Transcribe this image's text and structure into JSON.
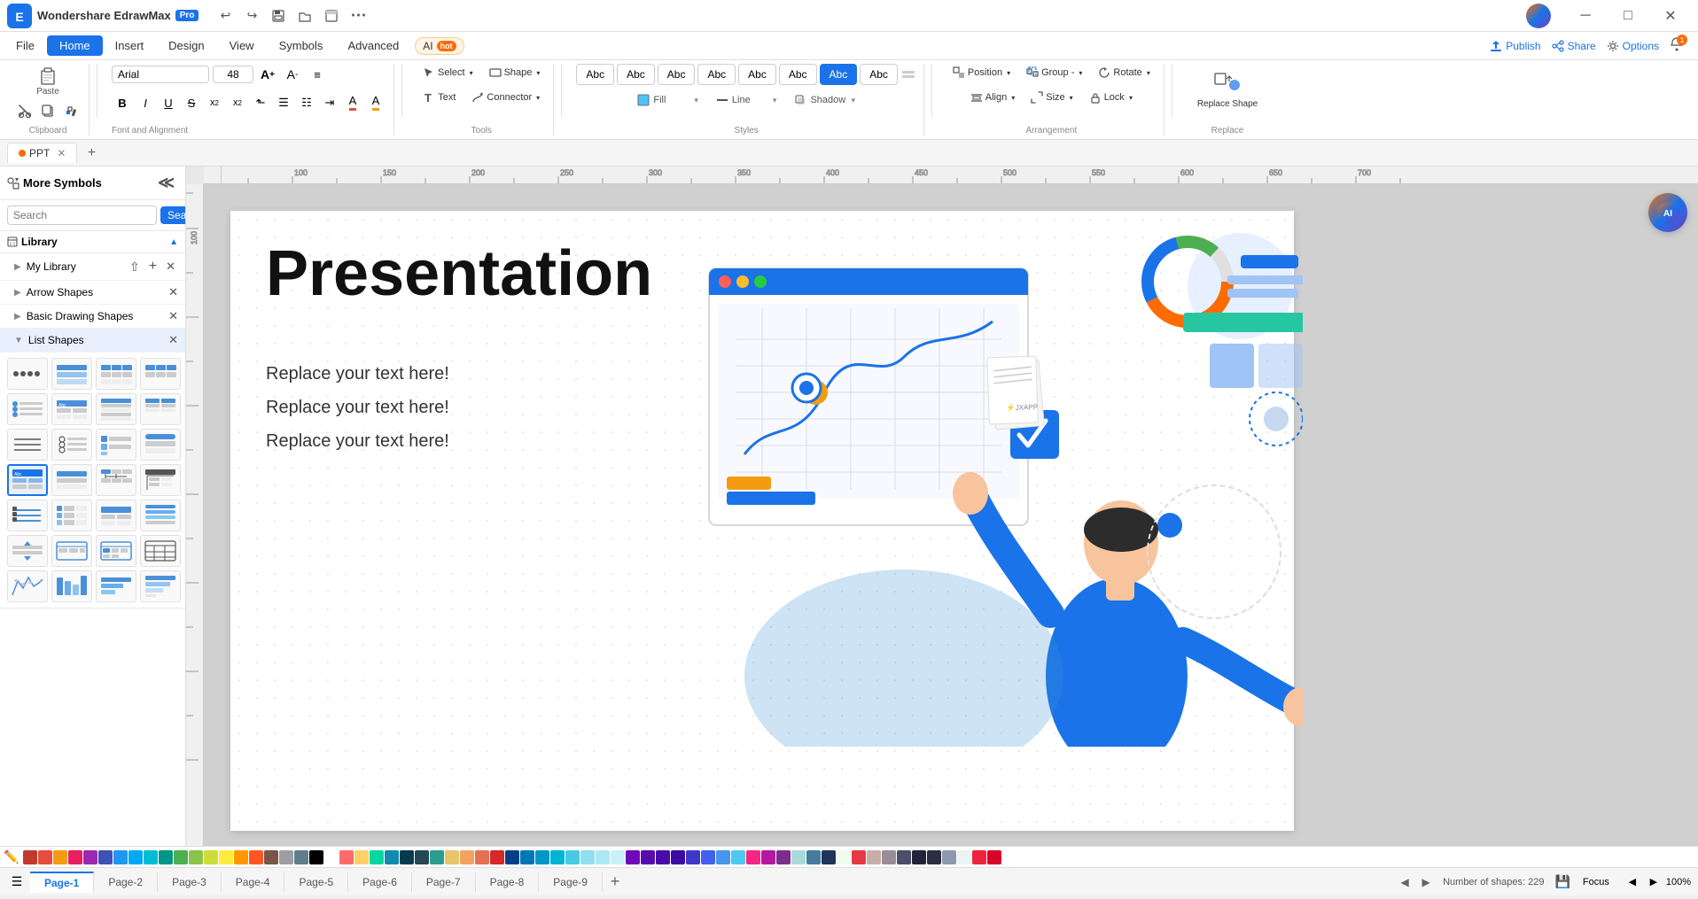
{
  "app": {
    "name": "Wondershare EdrawMax",
    "pro_badge": "Pro",
    "title": "Wondershare EdrawMax"
  },
  "titlebar": {
    "undo": "↩",
    "redo": "↪",
    "save_icon": "💾",
    "open_icon": "📂",
    "minimize": "─",
    "maximize": "□",
    "close": "✕",
    "more": "⋯"
  },
  "menubar": {
    "items": [
      "File",
      "Home",
      "Insert",
      "Design",
      "View",
      "Symbols",
      "Advanced"
    ],
    "active": "Home",
    "ai_label": "AI",
    "hot": "hot",
    "publish": "Publish",
    "share": "Share",
    "options": "Options"
  },
  "toolbar": {
    "clipboard_label": "Clipboard",
    "font_label": "Font and Alignment",
    "tools_label": "Tools",
    "styles_label": "Styles",
    "arrangement_label": "Arrangement",
    "replace_label": "Replace",
    "cut": "✂",
    "copy": "⧉",
    "paste": "📋",
    "format_painter": "🖌",
    "font_name": "Arial",
    "font_size": "48",
    "font_increase": "A+",
    "font_decrease": "A-",
    "align_icon": "≡",
    "bold": "B",
    "italic": "I",
    "underline": "U",
    "strikethrough": "S",
    "superscript": "x²",
    "subscript": "x₂",
    "text_align": "≡",
    "bullet_list": "☰",
    "numbered_list": "☷",
    "text_color": "A",
    "highlight": "A",
    "select_label": "Select",
    "shape_label": "Shape",
    "text_label": "Text",
    "connector_label": "Connector",
    "fill_label": "Fill",
    "line_label": "Line",
    "shadow_label": "Shadow",
    "position_label": "Position",
    "group_label": "Group -",
    "rotate_label": "Rotate",
    "align_label": "Align",
    "size_label": "Size",
    "lock_label": "Lock",
    "replace_shape_label": "Replace Shape",
    "style_swatches": [
      "Abc",
      "Abc",
      "Abc",
      "Abc",
      "Abc",
      "Abc",
      "Abc",
      "Abc"
    ]
  },
  "left_panel": {
    "title": "More Symbols",
    "search_placeholder": "Search",
    "search_btn": "Search",
    "library_label": "Library",
    "collapse_icon": "≪",
    "my_library": "My Library",
    "arrow_shapes": "Arrow Shapes",
    "basic_drawing": "Basic Drawing Shapes",
    "list_shapes": "List Shapes",
    "close_icon": "✕",
    "add_icon": "+"
  },
  "canvas": {
    "presentation_title": "Presentation",
    "text_lines": [
      "Replace your text here!",
      "Replace your text here!",
      "Replace your text here!"
    ]
  },
  "tabbar": {
    "tab_name": "PPT",
    "add_icon": "+"
  },
  "pages": {
    "pages": [
      "Page-1",
      "Page-2",
      "Page-3",
      "Page-4",
      "Page-5",
      "Page-6",
      "Page-7",
      "Page-8",
      "Page-9"
    ],
    "active": "Page-1",
    "shapes_count": "Number of shapes: 229",
    "zoom": "100%",
    "add_icon": "+",
    "focus": "Focus"
  },
  "statusbar": {
    "page_indicator": "Page-1",
    "shapes_count": "Number of shapes: 229",
    "zoom_level": "100%",
    "focus_btn": "Focus"
  },
  "colors": [
    "#c0392b",
    "#e74c3c",
    "#f39c12",
    "#e91e63",
    "#9c27b0",
    "#3f51b5",
    "#2196f3",
    "#03a9f4",
    "#00bcd4",
    "#009688",
    "#4caf50",
    "#8bc34a",
    "#cddc39",
    "#ffeb3b",
    "#ff9800",
    "#ff5722",
    "#795548",
    "#9e9e9e",
    "#607d8b",
    "#000000",
    "#ffffff",
    "#ff6b6b",
    "#ffd166",
    "#06d6a0",
    "#118ab2",
    "#073b4c",
    "#264653",
    "#2a9d8f",
    "#e9c46a",
    "#f4a261",
    "#e76f51",
    "#d62828",
    "#023e8a",
    "#0077b6",
    "#0096c7",
    "#00b4d8",
    "#48cae4",
    "#90e0ef",
    "#ade8f4",
    "#caf0f8",
    "#7209b7",
    "#560bad",
    "#480ca8",
    "#3a0ca3",
    "#3f37c9",
    "#4361ee",
    "#4895ef",
    "#4cc9f0",
    "#f72585",
    "#b5179e",
    "#7b2d8b",
    "#a8dadc",
    "#457b9d",
    "#1d3557",
    "#f1faee",
    "#e63946",
    "#c9ada7",
    "#9a8c98",
    "#4a4e69",
    "#22223b",
    "#2b2d42",
    "#8d99ae",
    "#edf2f4",
    "#ef233c",
    "#d90429"
  ]
}
